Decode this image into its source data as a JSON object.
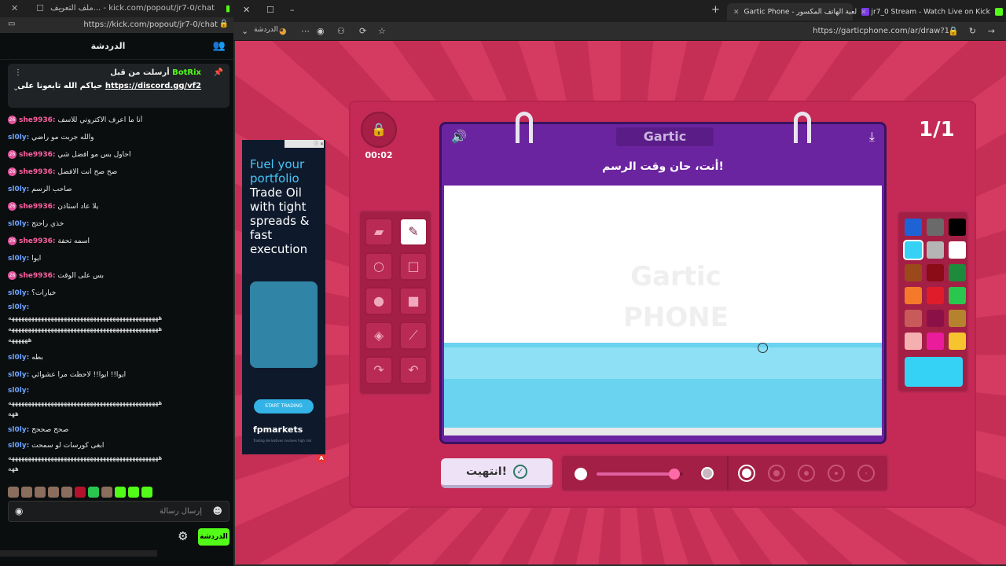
{
  "left_window": {
    "title": "ملف التعريف... - kick.com/popout/jr7-0/chat",
    "url": "https://kick.com/popout/jr7-0/chat",
    "chat_title": "الدردشة",
    "pinned": {
      "sent_by_label": "أرسلت من قبل",
      "bot": "BotRix",
      "message": "حياكم الله تابعونا على",
      "link": "https://discord.gg/vf2"
    },
    "messages": [
      {
        "user": "she9936",
        "text": "أنا ما اعرف الاكتروني للاسف",
        "color": "she"
      },
      {
        "user": "sl0ly",
        "text": "والله جربت مو راضي",
        "color": "sl"
      },
      {
        "user": "she9936",
        "text": "احاول بس مو افضل شي",
        "color": "she"
      },
      {
        "user": "she9936",
        "text": "صح صح انت الافضل",
        "color": "she"
      },
      {
        "user": "sl0ly",
        "text": "صاحب الرسم",
        "color": "sl"
      },
      {
        "user": "she9936",
        "text": "يلا عاد استاذن",
        "color": "she"
      },
      {
        "user": "sl0ly",
        "text": "خذي راحتج",
        "color": "sl"
      },
      {
        "user": "she9936",
        "text": "اسمه تحفة",
        "color": "she"
      },
      {
        "user": "sl0ly",
        "text": "ايوا",
        "color": "sl"
      },
      {
        "user": "she9936",
        "text": "بس على الوقت",
        "color": "she"
      },
      {
        "user": "sl0ly",
        "text": "خيارات؟",
        "color": "sl"
      },
      {
        "user": "sl0ly",
        "text": "",
        "color": "sl"
      },
      {
        "user": "",
        "text": "ههههههههههههههههههههههههههههههههههههههههههههههه",
        "color": "none"
      },
      {
        "user": "",
        "text": "ههههههههههههههههههههههههههههههههههههههههههههههه",
        "color": "none"
      },
      {
        "user": "",
        "text": "ههههههه",
        "color": "none"
      },
      {
        "user": "sl0ly",
        "text": "بطه",
        "color": "sl"
      },
      {
        "user": "sl0ly",
        "text": "ايوا!! ايوا!! لاحظت مرا عشوائي",
        "color": "sl"
      },
      {
        "user": "sl0ly",
        "text": "",
        "color": "sl"
      },
      {
        "user": "",
        "text": "ههههههههههههههههههههههههههههههههههههههههههههههه",
        "color": "none"
      },
      {
        "user": "",
        "text": "ههه",
        "color": "none"
      },
      {
        "user": "sl0ly",
        "text": "صحح صححح",
        "color": "sl"
      },
      {
        "user": "sl0ly",
        "text": "ابغى كورسات لو سمحت",
        "color": "sl"
      },
      {
        "user": "",
        "text": "ههههههههههههههههههههههههههههههههههههههههههههههه",
        "color": "none"
      },
      {
        "user": "",
        "text": "ههه",
        "color": "none"
      }
    ],
    "input_placeholder": "إرسال رسالة",
    "send_label": "الدردشة"
  },
  "browser": {
    "tabs": [
      {
        "label": "Gartic Phone - لعبة الهاتف المكسور",
        "active": true,
        "favicon_color": "#7c3aed"
      },
      {
        "label": "jr7_0 Stream - Watch Live on Kick",
        "active": false,
        "favicon_color": "#53fc18"
      }
    ],
    "profile_label": "الدردشة",
    "url": "https://garticphone.com/ar/draw?1"
  },
  "game": {
    "timer": "00:02",
    "round_counter": "1/1",
    "logo": "Gartic",
    "prompt": "أنت، حان وقت الرسم!",
    "watermark": "Gartic PHONE",
    "done_label": "انتهيت!",
    "palette": [
      "#1e63d6",
      "#6a6a6a",
      "#000000",
      "#35d2f5",
      "#b5b5b5",
      "#ffffff",
      "#9a4a1a",
      "#8b0b16",
      "#1e8a3c",
      "#f47a2a",
      "#e01c2a",
      "#2ac74e",
      "#c85a5a",
      "#8c1048",
      "#b5832e",
      "#f4b0b0",
      "#ea1c9c",
      "#f5c42e"
    ],
    "selected_color": "#35d2f5",
    "opacity": 0.9
  },
  "ad": {
    "headline_1": "Fuel your portfolio",
    "headline_2": "Trade Oil with tight spreads & fast execution",
    "cta": "START TRADING",
    "brand": "fpmarkets",
    "tagline": "Trading derivatives involves high risk"
  }
}
